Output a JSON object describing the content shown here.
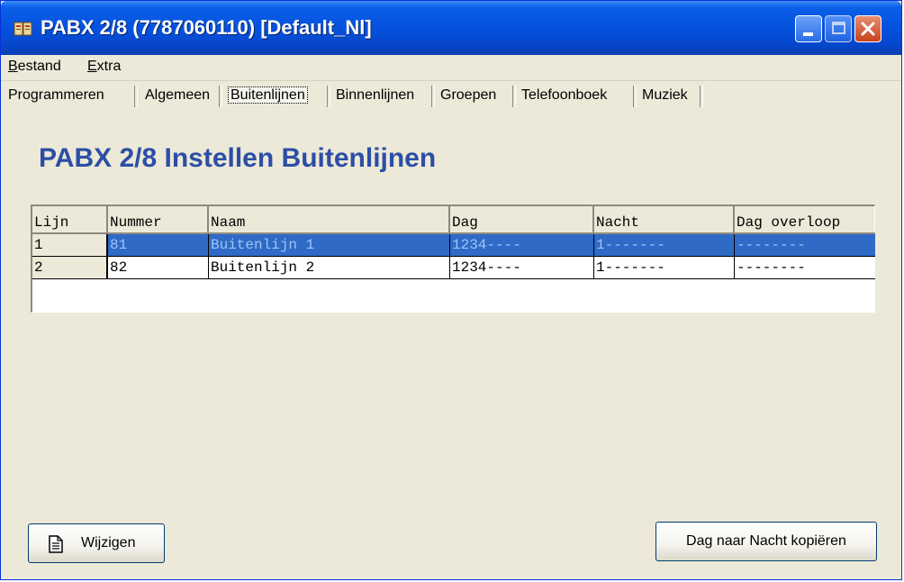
{
  "window": {
    "title": "PABX 2/8 (7787060110) [Default_Nl]"
  },
  "menu": {
    "items": [
      {
        "label_first": "B",
        "label_rest": "estand"
      },
      {
        "label_first": "E",
        "label_rest": "xtra"
      }
    ]
  },
  "tabs": [
    {
      "label": "Programmeren"
    },
    {
      "label": "Algemeen"
    },
    {
      "label": "Buitenlijnen",
      "active": true
    },
    {
      "label": "Binnenlijnen"
    },
    {
      "label": "Groepen"
    },
    {
      "label": "Telefoonboek"
    },
    {
      "label": "Muziek"
    }
  ],
  "heading": "PABX 2/8 Instellen Buitenlijnen",
  "grid": {
    "columns": [
      "Lijn",
      "Nummer",
      "Naam",
      "Dag",
      "Nacht",
      "Dag overloop"
    ],
    "rows": [
      {
        "lijn": "1",
        "nummer": "81",
        "naam": "Buitenlijn 1",
        "dag": "1234----",
        "nacht": "1-------",
        "overloop": "--------",
        "selected": true
      },
      {
        "lijn": "2",
        "nummer": "82",
        "naam": "Buitenlijn 2",
        "dag": "1234----",
        "nacht": "1-------",
        "overloop": "--------",
        "selected": false
      }
    ]
  },
  "buttons": {
    "edit": "Wijzigen",
    "copy": "Dag naar Nacht kopiëren"
  },
  "colors": {
    "titlebar": "#0550dc",
    "window_bg": "#ece9d8",
    "heading": "#2d4ea6",
    "selection": "#2f6ac6"
  },
  "icons": {
    "app": "phone-book-icon",
    "edit": "document-icon"
  }
}
